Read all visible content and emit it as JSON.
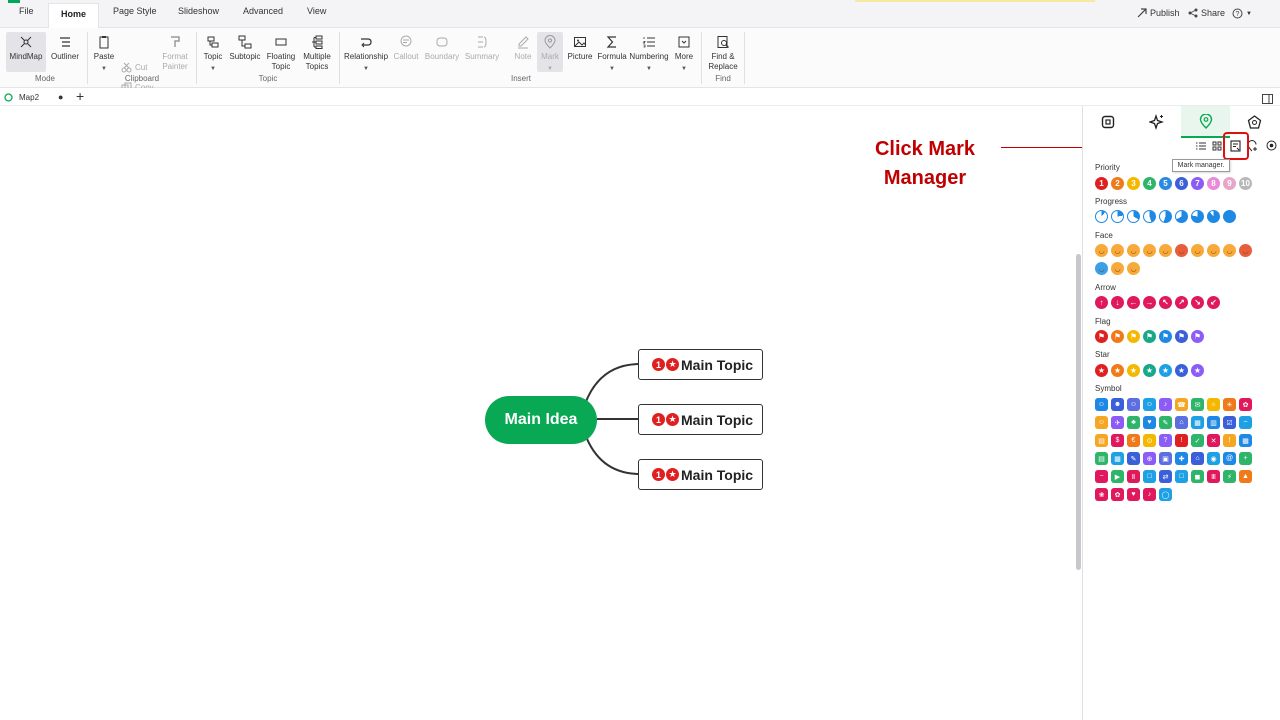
{
  "menu": {
    "tabs": [
      "File",
      "Home",
      "Page Style",
      "Slideshow",
      "Advanced",
      "View"
    ],
    "active_tab": "Home",
    "publish_label": "Publish",
    "share_label": "Share"
  },
  "ribbon": {
    "mindmap": "MindMap",
    "outliner": "Outliner",
    "mode_group": "Mode",
    "paste": "Paste",
    "cut": "Cut",
    "copy": "Copy",
    "format_painter_1": "Format",
    "format_painter_2": "Painter",
    "clipboard_group": "Clipboard",
    "topic": "Topic",
    "subtopic": "Subtopic",
    "floating_1": "Floating",
    "floating_2": "Topic",
    "multiple_1": "Multiple",
    "multiple_2": "Topics",
    "topic_group": "Topic",
    "relationship": "Relationship",
    "callout": "Callout",
    "boundary": "Boundary",
    "summary": "Summary",
    "note": "Note",
    "mark": "Mark",
    "picture": "Picture",
    "formula": "Formula",
    "numbering": "Numbering",
    "more": "More",
    "insert_group": "Insert",
    "find_1": "Find &",
    "find_2": "Replace",
    "find_group": "Find"
  },
  "doc": {
    "tab_name": "Map2"
  },
  "canvas": {
    "central": "Main Idea",
    "topics": [
      "Main Topic",
      "Main Topic",
      "Main Topic"
    ],
    "topic_mark_number": "1"
  },
  "annotation": {
    "line1": "Click Mark",
    "line2": "Manager"
  },
  "panel": {
    "tooltip": "Mark manager.",
    "sections": {
      "priority": "Priority",
      "progress": "Progress",
      "face": "Face",
      "arrow": "Arrow",
      "flag": "Flag",
      "star": "Star",
      "symbol": "Symbol"
    },
    "priority_numbers": [
      "1",
      "2",
      "3",
      "4",
      "5",
      "6",
      "7",
      "8",
      "9",
      "10"
    ],
    "priority_colors": [
      "#e02020",
      "#f07a1a",
      "#f5b800",
      "#2fb56a",
      "#2b8ae0",
      "#3a5fd8",
      "#8b5cf6",
      "#e88ad8",
      "#e7a6c8",
      "#b8b8b8"
    ],
    "progress_color": "#1e88e5",
    "arrow_color": "#e0185c",
    "flag_colors": [
      "#e02020",
      "#f07a1a",
      "#f5b800",
      "#17a88a",
      "#1e88e5",
      "#3a5fd8",
      "#8b5cf6"
    ],
    "star_colors": [
      "#e02020",
      "#f07a1a",
      "#f5b800",
      "#17a88a",
      "#1ea0e5",
      "#3a5fd8",
      "#8b5cf6"
    ],
    "brand_green": "#09a854",
    "annotation_red": "#c00000"
  }
}
